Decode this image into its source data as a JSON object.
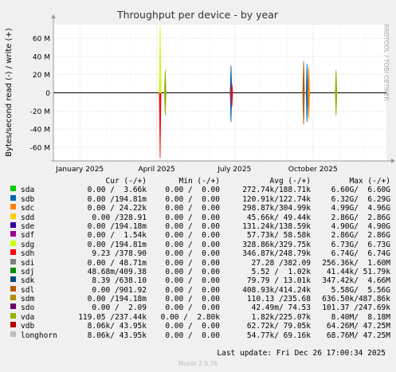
{
  "chart_data": {
    "type": "line",
    "title": "Throughput per device - by year",
    "ylabel": "Bytes/second read (-) / write (+)",
    "xlabel": "",
    "y_ticks": [
      {
        "value": 60000000,
        "label": "60 M"
      },
      {
        "value": 40000000,
        "label": "40 M"
      },
      {
        "value": 20000000,
        "label": "20 M"
      },
      {
        "value": 0,
        "label": "0"
      },
      {
        "value": -20000000,
        "label": "-20 M"
      },
      {
        "value": -40000000,
        "label": "-40 M"
      },
      {
        "value": -60000000,
        "label": "-60 M"
      }
    ],
    "ylim": [
      -75000000,
      75000000
    ],
    "x_ticks": [
      "January 2025",
      "April 2025",
      "July 2025",
      "October 2025"
    ],
    "x_tick_dates": [
      "2025-01-01",
      "2025-04-01",
      "2025-07-01",
      "2025-10-01"
    ],
    "xlim": [
      "2024-12-01",
      "2025-12-26"
    ],
    "grid": true,
    "spikes": [
      {
        "series": "sdh",
        "date": "2025-04-05",
        "write": 48000000,
        "read": -72000000
      },
      {
        "series": "sdg",
        "date": "2025-04-05",
        "write": 74000000,
        "read": 0
      },
      {
        "series": "vda",
        "date": "2025-04-11",
        "write": 25000000,
        "read": -25000000
      },
      {
        "series": "sdb",
        "date": "2025-06-27",
        "write": 30000000,
        "read": -32000000
      },
      {
        "series": "sdh",
        "date": "2025-06-28",
        "write": 10000000,
        "read": -15000000
      },
      {
        "series": "sdl",
        "date": "2025-09-20",
        "write": 35000000,
        "read": -35000000
      },
      {
        "series": "sdb",
        "date": "2025-09-24",
        "write": 32000000,
        "read": -32000000
      },
      {
        "series": "sdc",
        "date": "2025-09-26",
        "write": 28000000,
        "read": -28000000
      },
      {
        "series": "vda",
        "date": "2025-10-28",
        "write": 25000000,
        "read": -25000000
      }
    ],
    "series": [
      {
        "name": "sda",
        "color": "#00cc00",
        "cur": "0.00 /  3.66k",
        "min": "0.00 /  0.00",
        "avg": "272.74k/188.71k",
        "max": "6.60G/  6.60G"
      },
      {
        "name": "sdb",
        "color": "#0066b3",
        "cur": "0.00 /194.81m",
        "min": "0.00 /  0.00",
        "avg": "120.91k/122.74k",
        "max": "6.32G/  6.29G"
      },
      {
        "name": "sdc",
        "color": "#ff8000",
        "cur": "0.00 / 24.22k",
        "min": "0.00 /  0.00",
        "avg": "298.87k/304.99k",
        "max": "4.99G/  4.96G"
      },
      {
        "name": "sdd",
        "color": "#ffcc00",
        "cur": "0.00 /328.91",
        "min": "0.00 /  0.00",
        "avg": "45.66k/ 49.44k",
        "max": "2.86G/  2.86G"
      },
      {
        "name": "sde",
        "color": "#330099",
        "cur": "0.00 /194.18m",
        "min": "0.00 /  0.00",
        "avg": "131.24k/138.59k",
        "max": "4.90G/  4.90G"
      },
      {
        "name": "sdf",
        "color": "#990099",
        "cur": "0.00 /  1.54k",
        "min": "0.00 /  0.00",
        "avg": "57.73k/ 58.58k",
        "max": "2.86G/  2.86G"
      },
      {
        "name": "sdg",
        "color": "#ccff00",
        "cur": "0.00 /194.81m",
        "min": "0.00 /  0.00",
        "avg": "328.86k/329.75k",
        "max": "6.73G/  6.73G"
      },
      {
        "name": "sdh",
        "color": "#ff0000",
        "cur": "9.23 /378.90",
        "min": "0.00 /  0.00",
        "avg": "346.87k/248.79k",
        "max": "6.74G/  6.74G"
      },
      {
        "name": "sdi",
        "color": "#808080",
        "cur": "0.00 / 48.71m",
        "min": "0.00 /  0.00",
        "avg": "27.28 /382.09",
        "max": "256.36k/  1.60M"
      },
      {
        "name": "sdj",
        "color": "#008f00",
        "cur": "48.68m/409.38",
        "min": "0.00 /  0.00",
        "avg": "5.52 /  1.02k",
        "max": "41.44k/ 51.79k"
      },
      {
        "name": "sdk",
        "color": "#00487d",
        "cur": "8.39 /638.10",
        "min": "0.00 /  0.00",
        "avg": "79.79 / 13.01k",
        "max": "347.42k/  4.66M"
      },
      {
        "name": "sdl",
        "color": "#b35a00",
        "cur": "0.00 /901.92",
        "min": "0.00 /  0.00",
        "avg": "408.93k/414.24k",
        "max": "5.58G/  5.56G"
      },
      {
        "name": "sdm",
        "color": "#b38f00",
        "cur": "0.00 /194.18m",
        "min": "0.00 /  0.00",
        "avg": "110.13 /235.68",
        "max": "636.50k/487.86k"
      },
      {
        "name": "sdo",
        "color": "#6b006b",
        "cur": "0.00 /  2.09",
        "min": "0.00 /  0.00",
        "avg": "42.49m/ 74.53",
        "max": "101.37 /247.69k"
      },
      {
        "name": "vda",
        "color": "#8fb300",
        "cur": "119.05 /237.44k",
        "min": "0.00 /  2.80k",
        "avg": "1.82k/225.07k",
        "max": "8.40M/  8.18M"
      },
      {
        "name": "vdb",
        "color": "#b30000",
        "cur": "8.06k/ 43.95k",
        "min": "0.00 /  0.00",
        "avg": "62.72k/ 79.05k",
        "max": "64.26M/ 47.25M"
      },
      {
        "name": "longhorn",
        "color": "#bebebe",
        "cur": "8.06k/ 43.95k",
        "min": "0.00 /  0.00",
        "avg": "54.77k/ 69.16k",
        "max": "68.76M/ 47.25M"
      }
    ]
  },
  "legend_header": {
    "cur": "Cur (-/+)",
    "min": "Min (-/+)",
    "avg": "Avg (-/+)",
    "max": "Max (-/+)"
  },
  "last_update": "Last update: Fri Dec 26 17:00:34 2025",
  "footer": "Munin 2.0.76",
  "rrdtool_label": "RRDTOOL / TOBI OETIKER"
}
